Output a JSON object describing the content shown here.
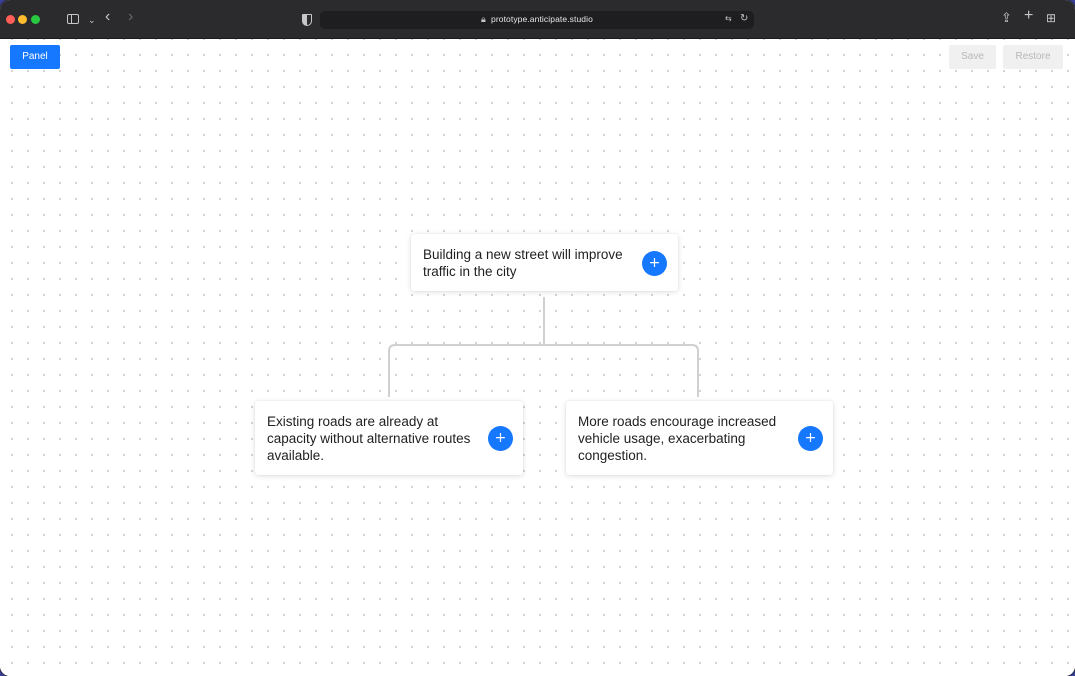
{
  "browser": {
    "url": "prototype.anticipate.studio",
    "icons": {
      "sidebar": "sidebar-icon",
      "back": "chevron-left-icon",
      "forward": "chevron-right-icon",
      "privacy": "shield-icon",
      "lock": "lock-icon",
      "translate": "translate-icon",
      "reload": "reload-icon",
      "share": "share-icon",
      "new_tab": "plus-icon",
      "tab_overview": "grid-icon"
    }
  },
  "toolbar": {
    "panel_label": "Panel",
    "save_label": "Save",
    "restore_label": "Restore"
  },
  "tree": {
    "root": {
      "text": "Building a new street will improve traffic in the city",
      "add_label": "+"
    },
    "children": [
      {
        "text": "Existing roads are already at capacity without alternative routes available.",
        "add_label": "+"
      },
      {
        "text": "More roads encourage increased vehicle usage, exacerbating congestion.",
        "add_label": "+"
      }
    ]
  },
  "colors": {
    "accent": "#1677ff",
    "connector": "#d0d0d0",
    "disabled_bg": "#f0f0f0",
    "disabled_text": "#b7b7b7"
  }
}
